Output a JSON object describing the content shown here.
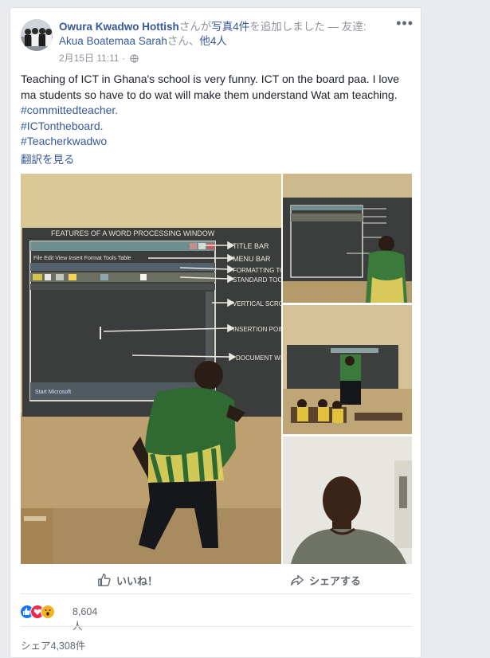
{
  "post": {
    "author": "Owura Kwadwo Hottish",
    "header_mid": "さんが",
    "photos_link": "写真4件",
    "header_end": "を追加しました — 友達:",
    "friend": "Akua Boatemaa Sarah",
    "friend_suffix": "さん、",
    "others": "他4人",
    "date": "2月15日 11:11 ·",
    "more": "•••",
    "text_line1": "Teaching of ICT in Ghana's school is very funny. ICT on the board paa. I love ma students so have to do wat will make them understand Wat am teaching.",
    "tags": [
      "#committedteacher.",
      "#ICTontheboard.",
      "#Teacherkwadwo"
    ],
    "translate": "翻訳を見る"
  },
  "chalkboard": {
    "title": "FEATURES OF A WORD PROCESSING WINDOW",
    "menu_line": "File Edit View Insert Format Tools Table",
    "labels": [
      "TITLE BAR",
      "MENU BAR",
      "FORMATTING TOOL",
      "STANDARD TOOLS",
      "VERTICAL SCROLL BAR",
      "INSERTION POINT",
      "DOCUMENT WINDOW"
    ]
  },
  "actions": {
    "like": "いいね！",
    "share": "シェアする"
  },
  "stats": {
    "reactions": "8,604人",
    "shares": "シェア4,308件"
  },
  "colors": {
    "link": "#365899",
    "like_blue": "#1877f2",
    "love_red": "#f0284a",
    "wow_yellow": "#f7b125"
  }
}
